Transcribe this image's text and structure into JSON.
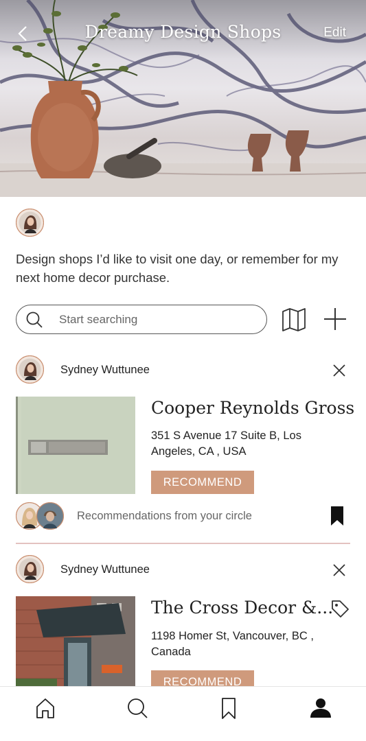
{
  "header": {
    "title": "Dreamy Design Shops",
    "edit_label": "Edit",
    "back_icon": "chevron-left-icon"
  },
  "list": {
    "description": "Design shops I’d like to visit one day, or remember for my next home decor purchase."
  },
  "search": {
    "placeholder": "Start searching",
    "map_icon": "map-icon",
    "add_icon": "plus-icon"
  },
  "cards": [
    {
      "user": "Sydney Wuttunee",
      "shop_name": "Cooper Reynolds Gross",
      "address": "351 S Avenue 17 Suite B, Los Angeles, CA , USA",
      "recommend_label": "RECOMMEND",
      "circle_text": "Recommendations from your circle",
      "bookmarked": true
    },
    {
      "user": "Sydney Wuttunee",
      "shop_name": "The Cross Decor &...",
      "address": "1198 Homer St, Vancouver, BC , Canada",
      "recommend_label": "RECOMMEND",
      "tag_icon": "tag-icon"
    }
  ],
  "tabbar": {
    "items": [
      "home-icon",
      "search-icon",
      "bookmark-icon",
      "profile-icon"
    ],
    "active": "profile-icon"
  },
  "colors": {
    "accent": "#cf9a7c",
    "divider": "#e3c2c0",
    "text": "#222222"
  }
}
